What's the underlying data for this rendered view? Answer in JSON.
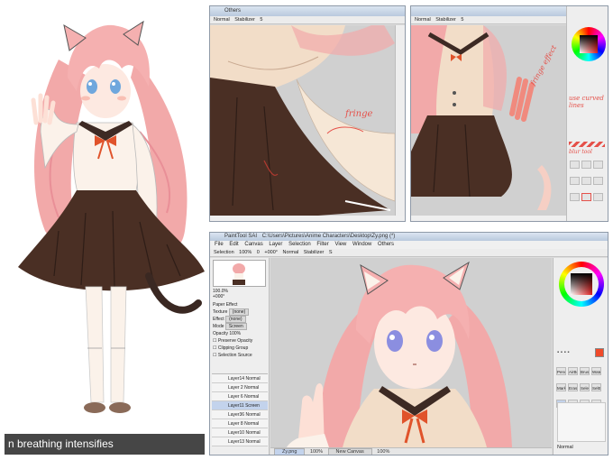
{
  "caption": "n breathing intensifies",
  "windows": {
    "mid_top": {
      "title": "Others",
      "toolbar": [
        "Normal",
        "Stabilizer",
        "5"
      ],
      "annotation": "fringe"
    },
    "right_top": {
      "toolbar": [
        "Normal",
        "Stabilizer",
        "5"
      ],
      "annotations": [
        "fringe effect",
        "use curved lines",
        "blur tool"
      ]
    },
    "main": {
      "title_app": "PaintTool SAI",
      "title_path": "C:\\Users\\Pictures\\Anime Characters\\Desktop\\Zy.png (*)",
      "menu": [
        "File",
        "Edit",
        "Canvas",
        "Layer",
        "Selection",
        "Filter",
        "View",
        "Window",
        "Others"
      ],
      "toolbar": [
        "Selection",
        "100%",
        "0",
        "+000°",
        "Normal",
        "Stabilizer",
        "S"
      ],
      "navigator": {
        "zoom": "100.0%",
        "angle": "+000°"
      },
      "layer_props": {
        "paper_effect": "Paper Effect",
        "texture_label": "Texture",
        "texture_value": "(none)",
        "effect_label": "Effect",
        "effect_value": "(none)",
        "mode_label": "Mode",
        "mode_value": "Screen",
        "opacity_label": "Opacity",
        "opacity_value": "100%",
        "checks": [
          "Preserve Opacity",
          "Clipping Group",
          "Selection Source"
        ]
      },
      "layers": [
        {
          "name": "Layer14",
          "mode": "Normal",
          "opacity": "100%"
        },
        {
          "name": "Layer 2",
          "mode": "Normal",
          "opacity": "100%"
        },
        {
          "name": "Layer 6",
          "mode": "Normal",
          "opacity": "100%"
        },
        {
          "name": "Layer11",
          "mode": "Screen",
          "opacity": "100%"
        },
        {
          "name": "Layer36",
          "mode": "Normal",
          "opacity": "100%"
        },
        {
          "name": "Layer 8",
          "mode": "Normal",
          "opacity": "100%"
        },
        {
          "name": "Layer10",
          "mode": "Normal",
          "opacity": "100%"
        },
        {
          "name": "Layer13",
          "mode": "Normal",
          "opacity": "100%"
        }
      ],
      "status_tabs": [
        "Zy.png",
        "100%",
        "New Canvas",
        "100%"
      ],
      "tools": [
        "Pencil",
        "AirBrush",
        "Brush",
        "Water",
        "Marker",
        "Eraser",
        "Select",
        "SelEras",
        "Blur",
        "Binary",
        "Color",
        "Bucket"
      ],
      "brush_mode": "Normal"
    }
  },
  "colors": {
    "hair": "#f2a9a9",
    "skirt": "#4a2f24",
    "bow": "#e0532b",
    "eyes": "#6fa7dd",
    "annotation": "#e5514a",
    "primary_color": "#f04a2a",
    "canvas_bg": "#d0d0d0"
  }
}
